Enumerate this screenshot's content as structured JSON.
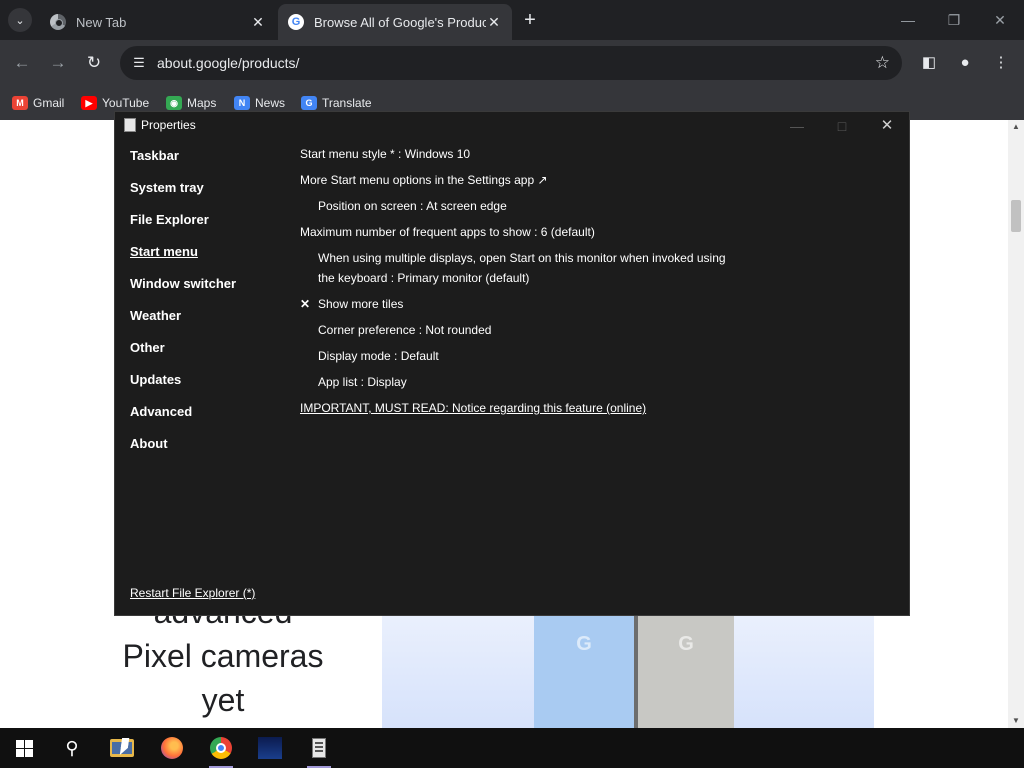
{
  "browser": {
    "tabs": [
      {
        "title": "New Tab",
        "favicon": "chrome-icon",
        "active": false
      },
      {
        "title": "Browse All of Google's Products",
        "favicon": "google-icon",
        "active": true
      }
    ],
    "url": "about.google/products/",
    "bookmarks": [
      {
        "label": "Gmail",
        "icon": "gmail-icon",
        "color": "#ea4335"
      },
      {
        "label": "YouTube",
        "icon": "youtube-icon",
        "color": "#ff0000"
      },
      {
        "label": "Maps",
        "icon": "maps-icon",
        "color": "#34a853"
      },
      {
        "label": "News",
        "icon": "news-icon",
        "color": "#4285f4"
      },
      {
        "label": "Translate",
        "icon": "translate-icon",
        "color": "#4285f4"
      }
    ]
  },
  "page": {
    "hero_lines": [
      "advanced",
      "Pixel cameras",
      "yet"
    ],
    "phone_logo": "G"
  },
  "dialog": {
    "title": "Properties",
    "sidebar": [
      {
        "label": "Taskbar",
        "active": false
      },
      {
        "label": "System tray",
        "active": false
      },
      {
        "label": "File Explorer",
        "active": false
      },
      {
        "label": "Start menu",
        "active": true
      },
      {
        "label": "Window switcher",
        "active": false
      },
      {
        "label": "Weather",
        "active": false
      },
      {
        "label": "Other",
        "active": false
      },
      {
        "label": "Updates",
        "active": false
      },
      {
        "label": "Advanced",
        "active": false
      },
      {
        "label": "About",
        "active": false
      }
    ],
    "settings": {
      "start_menu_style": "Start menu style * : Windows 10",
      "more_options": "More Start menu options in the Settings app ↗",
      "position": "Position on screen : At screen edge",
      "max_frequent": "Maximum number of frequent apps to show : 6 (default)",
      "multi_display": "When using multiple displays, open Start on this monitor when invoked using the keyboard : Primary monitor (default)",
      "show_more_tiles": "Show more tiles",
      "show_more_tiles_check": "✕",
      "corner": "Corner preference : Not rounded",
      "display_mode": "Display mode : Default",
      "app_list": "App list : Display",
      "important": "IMPORTANT, MUST READ: Notice regarding this feature (online)"
    },
    "restart": "Restart File Explorer (*)"
  },
  "taskbar": {
    "items": [
      "start",
      "search",
      "file-explorer",
      "firefox",
      "chrome",
      "disney-plus",
      "properties"
    ]
  }
}
